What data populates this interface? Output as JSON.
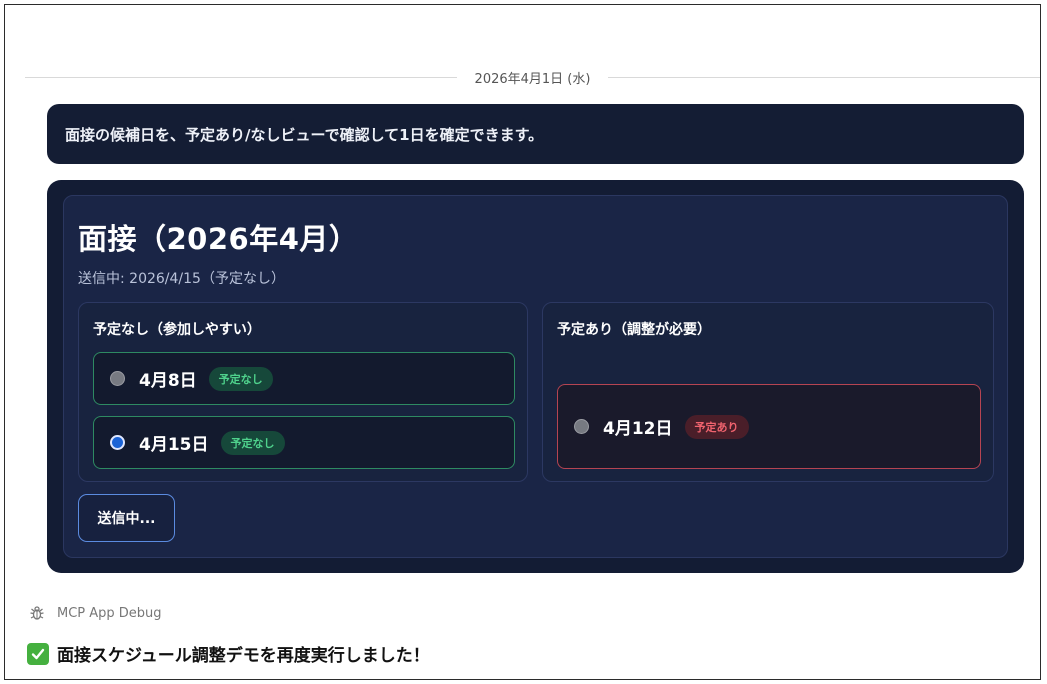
{
  "chat": {
    "date_divider": "2026年4月1日 (水)",
    "message": "面接の候補日を、予定あり/なしビューで確認して1日を確定できます。"
  },
  "app": {
    "title": "面接（2026年4月）",
    "status": "送信中: 2026/4/15（予定なし）",
    "free_column": {
      "heading": "予定なし（参加しやすい）",
      "options": [
        {
          "date": "4月8日",
          "tag": "予定なし",
          "selected": false
        },
        {
          "date": "4月15日",
          "tag": "予定なし",
          "selected": true
        }
      ]
    },
    "busy_column": {
      "heading": "予定あり（調整が必要）",
      "options": [
        {
          "date": "4月12日",
          "tag": "予定あり",
          "selected": false
        }
      ]
    },
    "send_label": "送信中..."
  },
  "debug": {
    "label": "MCP App Debug",
    "icon": "bug-icon"
  },
  "result": {
    "icon": "check-mark-icon",
    "text": "面接スケジュール調整デモを再度実行しました！"
  },
  "colors": {
    "card_bg": "#131c34",
    "free_accent": "#2e8a62",
    "busy_accent": "#b54452",
    "button_border": "#5b8be0"
  }
}
